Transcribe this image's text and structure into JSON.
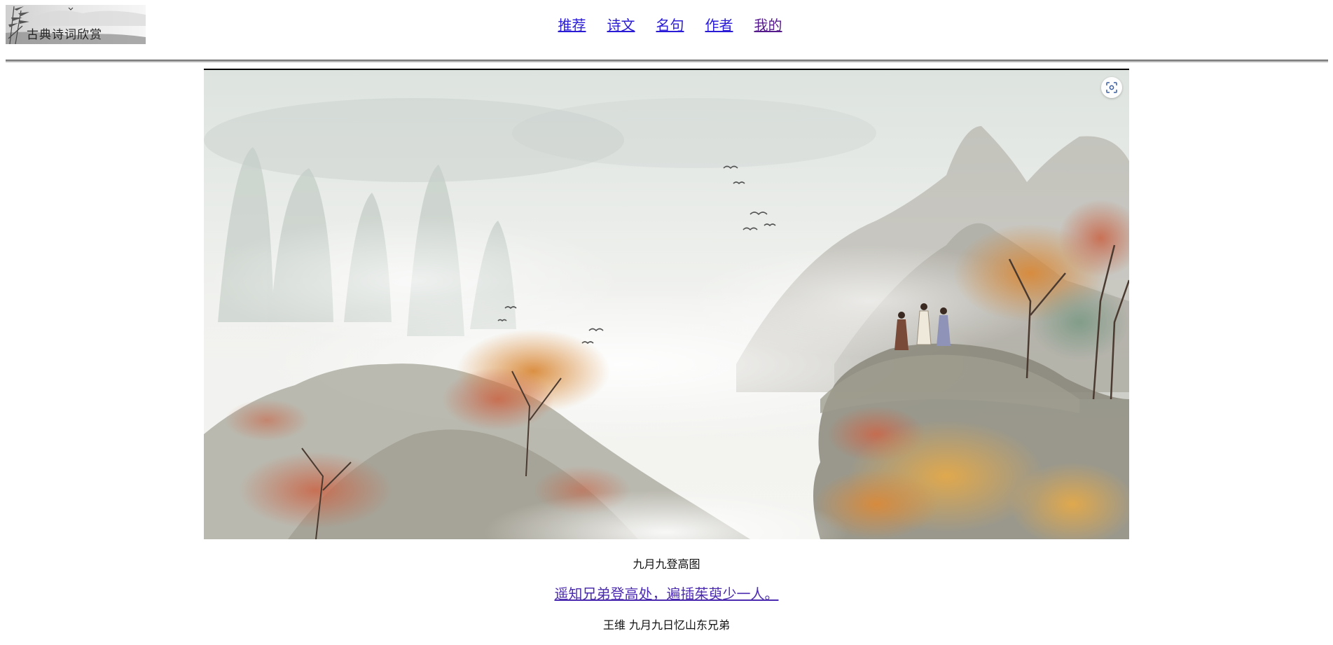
{
  "header": {
    "logo_text": "古典诗词欣赏"
  },
  "nav": {
    "items": [
      {
        "label": "推荐"
      },
      {
        "label": "诗文"
      },
      {
        "label": "名句"
      },
      {
        "label": "作者"
      },
      {
        "label": "我的"
      }
    ]
  },
  "hero": {
    "icon": "lens-icon"
  },
  "caption": {
    "title": "九月九登高图",
    "poem_line": "遥知兄弟登高处，遍插茱萸少一人。",
    "source": "王维 九月九日忆山东兄弟"
  }
}
